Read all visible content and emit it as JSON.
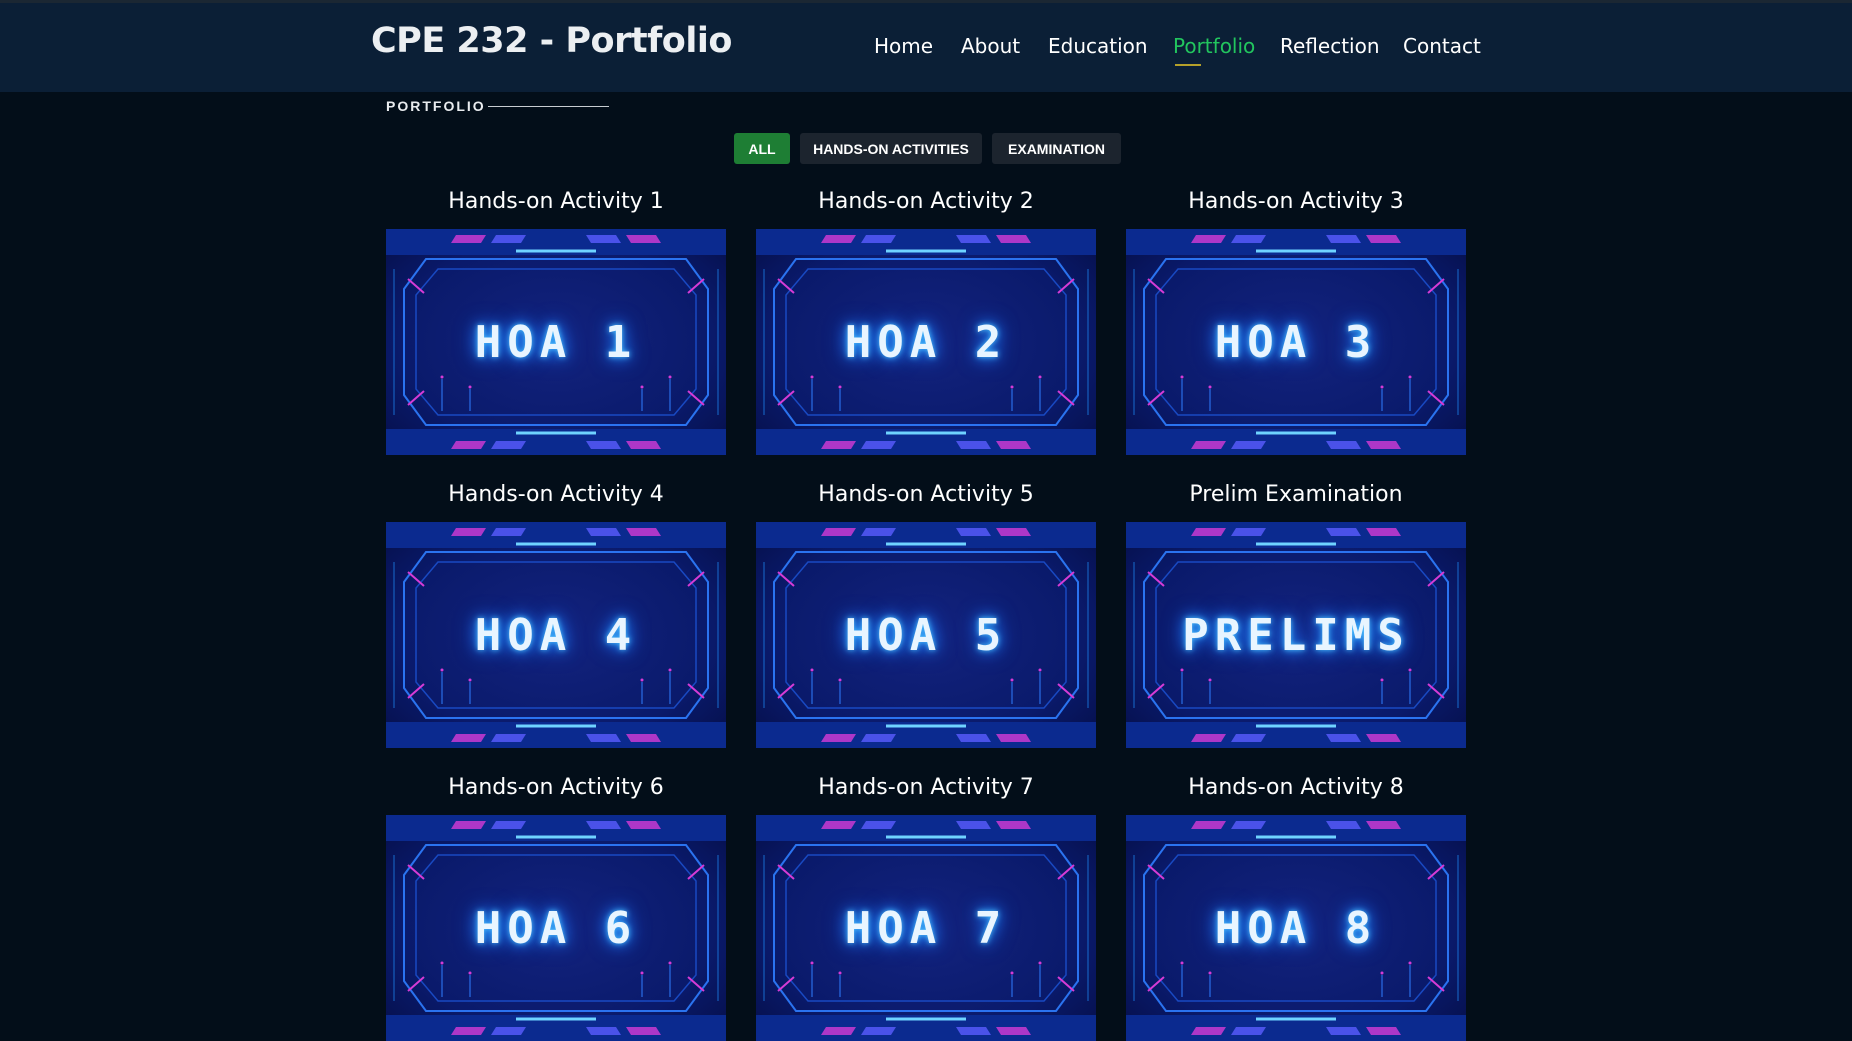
{
  "header": {
    "brand": "CPE 232 - Portfolio",
    "nav": [
      "Home",
      "About",
      "Education",
      "Portfolio",
      "Reflection",
      "Contact"
    ],
    "active_nav": "Portfolio"
  },
  "section": {
    "label": "PORTFOLIO"
  },
  "filters": [
    "ALL",
    "HANDS-ON ACTIVITIES",
    "EXAMINATION"
  ],
  "active_filter": "ALL",
  "items": [
    {
      "title": "Hands-on Activity 1",
      "thumb_text": "HOA 1"
    },
    {
      "title": "Hands-on Activity 2",
      "thumb_text": "HOA 2"
    },
    {
      "title": "Hands-on Activity 3",
      "thumb_text": "HOA 3"
    },
    {
      "title": "Hands-on Activity 4",
      "thumb_text": "HOA 4"
    },
    {
      "title": "Hands-on Activity 5",
      "thumb_text": "HOA 5"
    },
    {
      "title": "Prelim Examination",
      "thumb_text": "PRELIMS"
    },
    {
      "title": "Hands-on Activity 6",
      "thumb_text": "HOA 6"
    },
    {
      "title": "Hands-on Activity 7",
      "thumb_text": "HOA 7"
    },
    {
      "title": "Hands-on Activity 8",
      "thumb_text": "HOA 8"
    }
  ],
  "colors": {
    "page_bg": "#030e19",
    "header_bg": "#0b1f36",
    "accent_green": "#22c55e",
    "filter_active_bg": "#1e7e34",
    "filter_bg": "#1c242e",
    "thumb_bg": "#0a1a6b",
    "thumb_glow": "#4cc4ff",
    "thumb_magenta": "#d63bd6"
  }
}
